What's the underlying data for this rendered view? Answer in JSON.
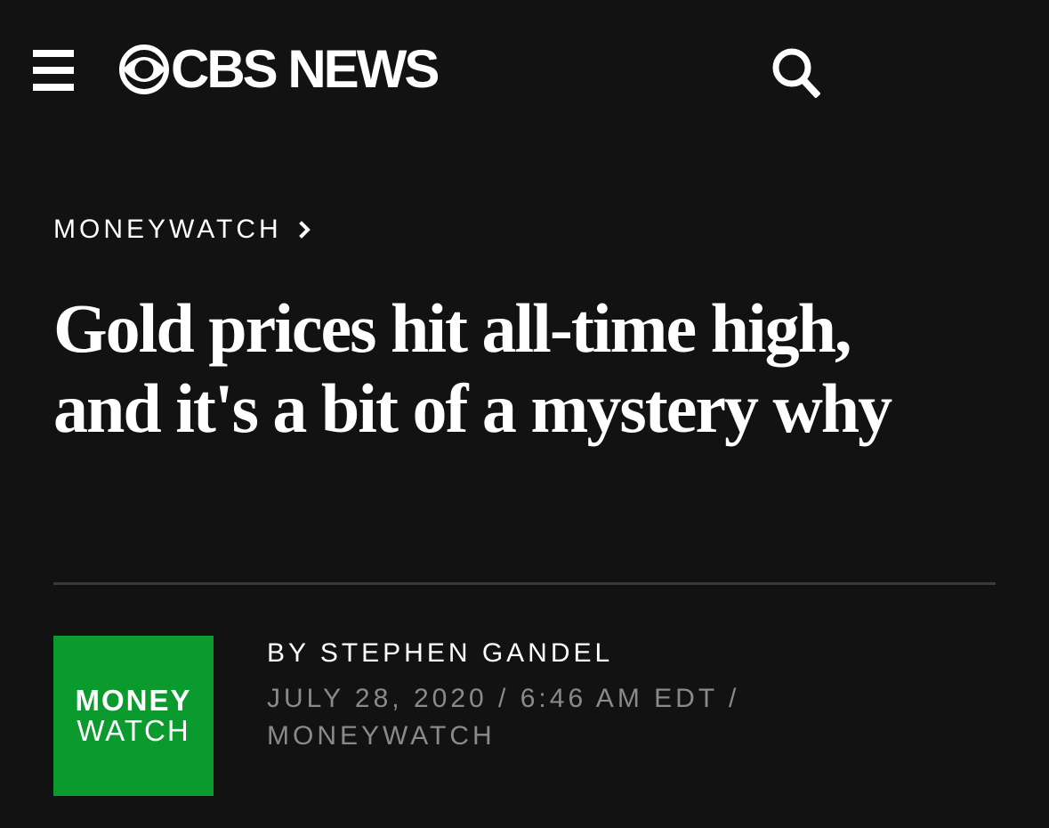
{
  "header": {
    "menu_icon": "hamburger-menu-icon",
    "logo_icon": "cbs-eye-icon",
    "logo_text": "CBS NEWS",
    "search_icon": "search-icon"
  },
  "article": {
    "section": "MONEYWATCH",
    "section_chevron_icon": "chevron-right-icon",
    "headline": "Gold prices hit all-time high, and it's a bit of a mystery why",
    "byline": "BY STEPHEN GANDEL",
    "date": "JULY 28, 2020",
    "time": "6:46 AM EDT",
    "separator": "/",
    "source": "MONEYWATCH"
  },
  "moneywatch_logo": {
    "line1": "MONEY",
    "line2": "WATCH",
    "color": "#0a9a2e"
  },
  "colors": {
    "background": "#121212",
    "text": "#ffffff",
    "meta_text": "#8a8a8a",
    "divider": "#3a3a3a"
  }
}
